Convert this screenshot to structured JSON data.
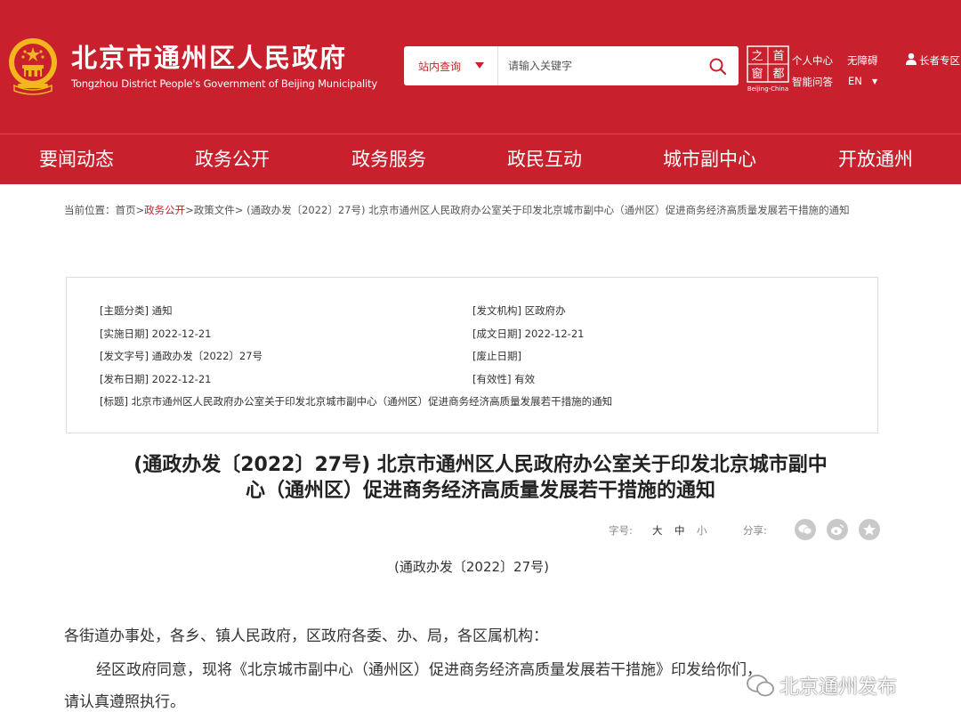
{
  "header": {
    "title": "北京市通州区人民政府",
    "subtitle": "Tongzhou District People's Government of Beijing Municipality",
    "search_scope": "站内查询",
    "search_placeholder": "请输入关键字",
    "capital_logo": {
      "chars": [
        "之",
        "首",
        "窗",
        "都"
      ],
      "caption": "Beijing-China"
    },
    "links": {
      "personal_center": "个人中心",
      "accessibility": "无障碍",
      "elder": "长者专区",
      "smart_qa": "智能问答",
      "language": "EN"
    },
    "brand_color": "#c8202c"
  },
  "nav": [
    "要闻动态",
    "政务公开",
    "政务服务",
    "政民互动",
    "城市副中心",
    "开放通州"
  ],
  "breadcrumb": {
    "prefix": "当前位置：",
    "home": "首页",
    "sep": ">",
    "section": "政务公开",
    "category": "政策文件",
    "current": " (通政办发〔2022〕27号) 北京市通州区人民政府办公室关于印发北京城市副中心（通州区）促进商务经济高质量发展若干措施的通知"
  },
  "info": {
    "topic": "[主题分类] 通知",
    "issuer": "[发文机构] 区政府办",
    "effective_date": "[实施日期] 2022-12-21",
    "written_date": "[成文日期] 2022-12-21",
    "doc_no": "[发文字号] 通政办发〔2022〕27号",
    "repeal_date": "[废止日期]",
    "publish_date": "[发布日期] 2022-12-21",
    "validity": "[有效性] 有效",
    "title": "[标题] 北京市通州区人民政府办公室关于印发北京城市副中心（通州区）促进商务经济高质量发展若干措施的通知"
  },
  "article": {
    "title_line1": "(通政办发〔2022〕27号) 北京市通州区人民政府办公室关于印发北京城市副中",
    "title_line2": "心（通州区）促进商务经济高质量发展若干措施的通知",
    "font_size_label": "字号:",
    "font_sizes": [
      "大",
      "中",
      "小"
    ],
    "share_label": "分享:",
    "share_icons": [
      "wechat-icon",
      "weibo-icon",
      "favorite-icon"
    ],
    "doc_number": "(通政办发〔2022〕27号)",
    "para1": "各街道办事处，各乡、镇人民政府，区政府各委、办、局，各区属机构：",
    "para2_line1": "经区政府同意，现将《北京城市副中心（通州区）促进商务经济高质量发展若干措施》印发给你们，",
    "para2_line2": "请认真遵照执行。"
  },
  "watermark": "北京通州发布"
}
